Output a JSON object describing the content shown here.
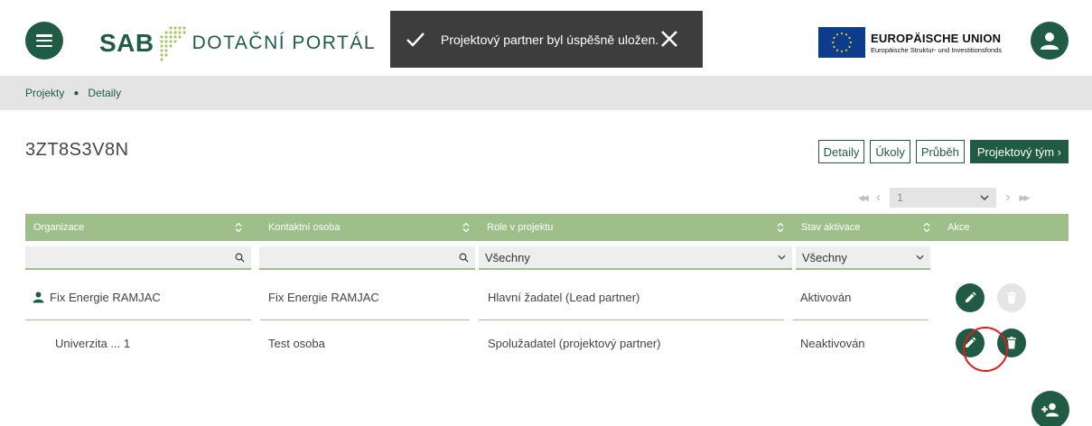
{
  "header": {
    "logo_sab": "SAB",
    "logo_title": "DOTAČNÍ PORTÁL",
    "eu_title": "EUROPÄISCHE UNION",
    "eu_subtitle": "Europäische Struktur- und Investitionsfonds"
  },
  "toast": {
    "message": "Projektový partner byl úspěšně uložen."
  },
  "breadcrumb": {
    "items": [
      "Projekty",
      "Detaily"
    ]
  },
  "project": {
    "title": "3ZT8S3V8N"
  },
  "tabs": [
    {
      "label": "Detaily",
      "active": false
    },
    {
      "label": "Úkoly",
      "active": false
    },
    {
      "label": "Průběh",
      "active": false
    },
    {
      "label": "Projektový tým ›",
      "active": true
    }
  ],
  "pager": {
    "current_page": "1",
    "first": "◀◀",
    "prev": "‹",
    "next": "›",
    "last": "▶▶"
  },
  "table": {
    "columns": [
      "Organizace",
      "Kontaktní osoba",
      "Role v projektu",
      "Stav aktivace",
      "Akce"
    ],
    "filters": {
      "organizace": "",
      "kontaktni_osoba": "",
      "role": "Všechny",
      "stav": "Všechny"
    },
    "rows": [
      {
        "organizace": "Fix Energie RAMJAC",
        "kontaktni_osoba": "Fix Energie RAMJAC",
        "role": "Hlavní žadatel (Lead partner)",
        "stav": "Aktivován",
        "lead": true,
        "delete_enabled": false
      },
      {
        "organizace": "Univerzita ... 1",
        "kontaktni_osoba": "Test osoba",
        "role": "Spolužadatel (projektový partner)",
        "stav": "Neaktivován",
        "lead": false,
        "delete_enabled": true
      }
    ]
  },
  "colors": {
    "primary": "#1f5c43",
    "table_header": "#9fbf8a",
    "toast_bg": "#3d3d3d",
    "highlight": "#e01b1b"
  },
  "icons": {
    "menu": "menu-icon",
    "avatar": "user-icon",
    "toast_check": "check-icon",
    "toast_close": "close-icon",
    "edit": "pencil-icon",
    "delete": "trash-icon",
    "add_person": "person-add-icon",
    "search": "search-icon",
    "sort": "sort-icon"
  }
}
